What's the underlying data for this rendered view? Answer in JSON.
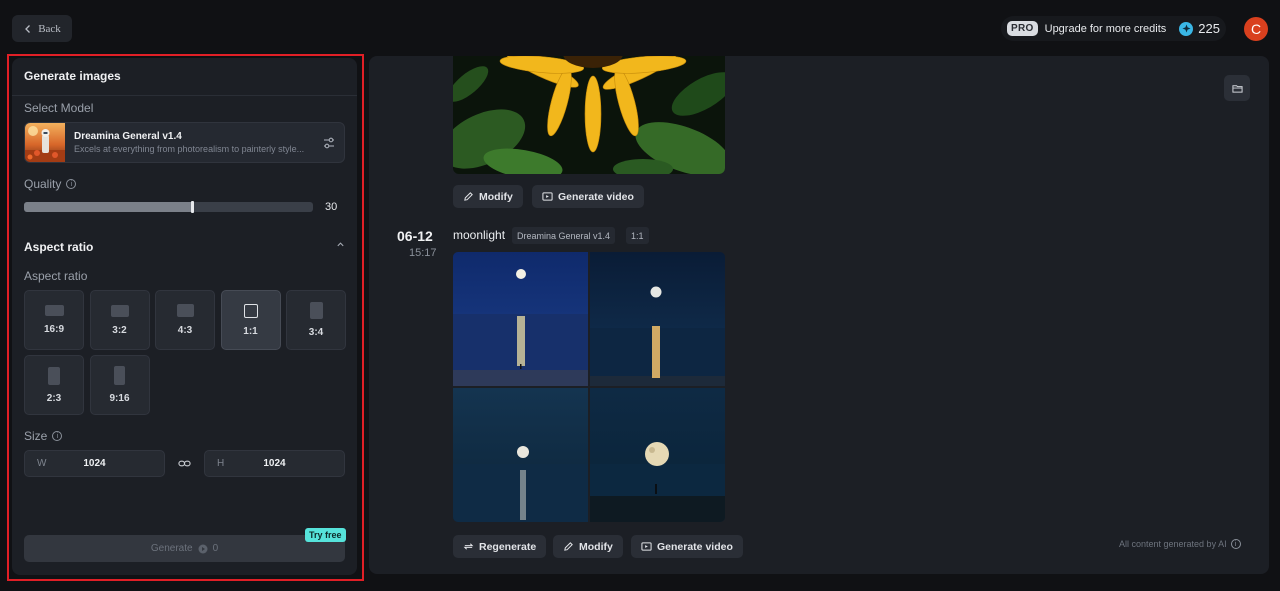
{
  "topbar": {
    "back_label": "Back",
    "pro_badge": "PRO",
    "upgrade_label": "Upgrade for more credits",
    "credits": "225",
    "avatar_initial": "C"
  },
  "left_panel": {
    "title": "Generate images",
    "select_model_label": "Select Model",
    "model": {
      "name": "Dreamina General v1.4",
      "description": "Excels at everything from photorealism to painterly style..."
    },
    "quality": {
      "label": "Quality",
      "value": "30",
      "level": 0.58
    },
    "aspect_section_title": "Aspect ratio",
    "aspect_label": "Aspect ratio",
    "ratios": [
      {
        "label": "16:9",
        "active": false
      },
      {
        "label": "3:2",
        "active": false
      },
      {
        "label": "4:3",
        "active": false
      },
      {
        "label": "1:1",
        "active": true
      },
      {
        "label": "3:4",
        "active": false
      },
      {
        "label": "2:3",
        "active": false
      },
      {
        "label": "9:16",
        "active": false
      }
    ],
    "size": {
      "label": "Size",
      "w_prefix": "W",
      "w_value": "1024",
      "h_prefix": "H",
      "h_value": "1024"
    },
    "generate": {
      "label": "Generate",
      "cost": "0",
      "try_free": "Try free"
    }
  },
  "main": {
    "first_actions": {
      "modify": "Modify",
      "generate_video": "Generate video"
    },
    "entry": {
      "date": "06-12",
      "time": "15:17",
      "prompt": "moonlight",
      "model_tag": "Dreamina General v1.4",
      "ratio_tag": "1:1"
    },
    "second_actions": {
      "regenerate": "Regenerate",
      "modify": "Modify",
      "generate_video": "Generate video"
    },
    "ai_note": "All content generated by AI"
  },
  "colors": {
    "accent_red": "#e11f26",
    "try_free_bg": "#56e3db",
    "avatar_bg": "#d9401e"
  }
}
